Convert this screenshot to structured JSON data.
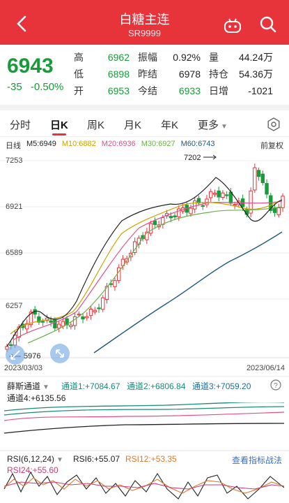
{
  "header": {
    "title": "白糖主连",
    "code": "SR9999"
  },
  "quote": {
    "price": "6943",
    "change": "-35",
    "change_pct": "-0.50%",
    "rows": [
      {
        "l1": "高",
        "v1": "6962",
        "l2": "振幅",
        "v2": "0.92%",
        "l3": "量",
        "v3": "44.24万"
      },
      {
        "l1": "低",
        "v1": "6898",
        "l2": "昨结",
        "v2": "6978",
        "l3": "持仓",
        "v3": "54.36万"
      },
      {
        "l1": "开",
        "v1": "6953",
        "l2": "今结",
        "v2": "6933",
        "l3": "日增",
        "v3": "-1021"
      }
    ]
  },
  "tabs": [
    {
      "label": "分时"
    },
    {
      "label": "日K"
    },
    {
      "label": "周K"
    },
    {
      "label": "月K"
    },
    {
      "label": "年K"
    },
    {
      "label": "更多"
    }
  ],
  "ma_legend": {
    "type": "日线",
    "items": [
      {
        "label": "M5:6949",
        "color": "#222222"
      },
      {
        "label": "M10:6882",
        "color": "#c9a400"
      },
      {
        "label": "M20:6936",
        "color": "#e0508a"
      },
      {
        "label": "M30:6927",
        "color": "#6bb04a"
      },
      {
        "label": "M60:6743",
        "color": "#1f5a7a"
      }
    ],
    "adjust": "前复权"
  },
  "chart": {
    "y_ticks": [
      "7253",
      "6921",
      "6589",
      "6257"
    ],
    "max_label": "7202",
    "min_label": "5976",
    "date_start": "2023/03/03",
    "date_end": "2023/06/14"
  },
  "channel": {
    "name": "薛斯通道",
    "lines": [
      {
        "label": "通道1:+7084.67",
        "color": "#1a8a7a"
      },
      {
        "label": "通道2:+6806.84",
        "color": "#1a8a7a"
      },
      {
        "label": "通道3:+7059.20",
        "color": "#1a6f9a"
      },
      {
        "label": "通道4:+6135.56",
        "color": "#222222"
      }
    ]
  },
  "rsi": {
    "name": "RSI(6,12,24)",
    "lines": [
      {
        "label": "RSI6:+55.07",
        "color": "#222222"
      },
      {
        "label": "RSI12:+53.35",
        "color": "#e07a2a"
      },
      {
        "label": "RSI24:+55.60",
        "color": "#c83a7a"
      }
    ],
    "link": "查看指标战法"
  }
}
